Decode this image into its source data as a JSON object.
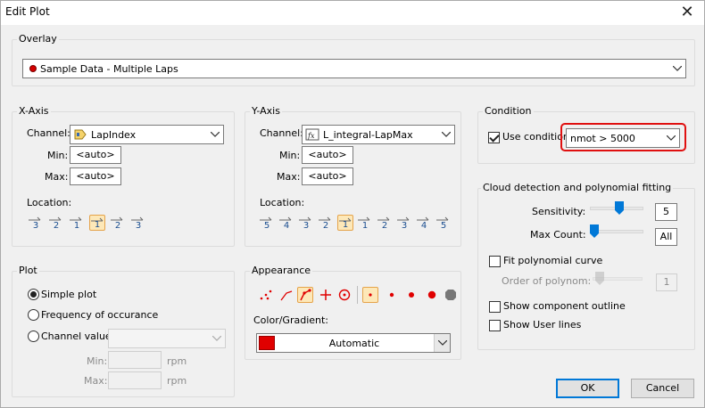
{
  "window": {
    "title": "Edit Plot",
    "close_glyph": "✕"
  },
  "overlay": {
    "group_label": "Overlay",
    "value": "Sample Data - Multiple Laps",
    "dot_color": "#d40000"
  },
  "xaxis": {
    "group_label": "X-Axis",
    "channel_label": "Channel:",
    "channel_value": "LapIndex",
    "min_label": "Min:",
    "min_value": "<auto>",
    "max_label": "Max:",
    "max_value": "<auto>",
    "location_label": "Location:",
    "locations": [
      "3",
      "2",
      "1",
      "1",
      "2",
      "3"
    ],
    "selected_location": 3
  },
  "yaxis": {
    "group_label": "Y-Axis",
    "channel_label": "Channel:",
    "channel_value": "L_integral-LapMax",
    "min_label": "Min:",
    "min_value": "<auto>",
    "max_label": "Max:",
    "max_value": "<auto>",
    "location_label": "Location:",
    "locations": [
      "5",
      "4",
      "3",
      "2",
      "1",
      "1",
      "2",
      "3",
      "4",
      "5"
    ],
    "selected_location": 4
  },
  "condition": {
    "group_label": "Condition",
    "use_label": "Use condition:",
    "use_checked": true,
    "value": "nmot > 5000",
    "highlight_color": "#e01010"
  },
  "cloud": {
    "group_label": "Cloud detection and polynomial fitting",
    "sensitivity_label": "Sensitivity:",
    "sensitivity_value": "5",
    "sensitivity_level": 0.55,
    "maxcount_label": "Max Count:",
    "maxcount_value": "All",
    "maxcount_level": 0.0,
    "fit_label": "Fit polynomial curve",
    "fit_checked": false,
    "order_label": "Order of polynom:",
    "order_value": "1",
    "outline_label": "Show component outline",
    "outline_checked": false,
    "userlines_label": "Show User lines",
    "userlines_checked": false
  },
  "plot": {
    "group_label": "Plot",
    "options": [
      "Simple plot",
      "Frequency of occurance",
      "Channel value"
    ],
    "selected": 0,
    "min_label": "Min:",
    "max_label": "Max:",
    "min_unit": "rpm",
    "max_unit": "rpm"
  },
  "appearance": {
    "group_label": "Appearance",
    "color_label": "Color/Gradient:",
    "color_value": "Automatic",
    "swatch": "#e00000",
    "marker_color": "#e00000",
    "selected_style": 2,
    "selected_marker": 0
  },
  "buttons": {
    "ok": "OK",
    "cancel": "Cancel"
  }
}
